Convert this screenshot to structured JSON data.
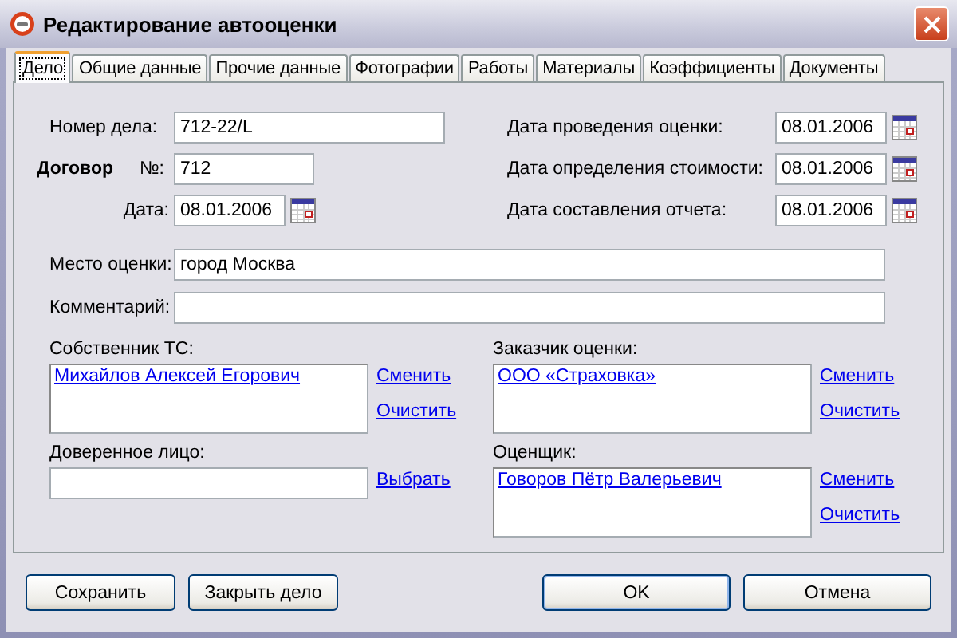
{
  "window": {
    "title": "Редактирование автооценки"
  },
  "tabs": [
    {
      "label": "Дело",
      "selected": true
    },
    {
      "label": "Общие данные",
      "selected": false
    },
    {
      "label": "Прочие данные",
      "selected": false
    },
    {
      "label": "Фотографии",
      "selected": false
    },
    {
      "label": "Работы",
      "selected": false
    },
    {
      "label": "Материалы",
      "selected": false
    },
    {
      "label": "Коэффициенты",
      "selected": false
    },
    {
      "label": "Документы",
      "selected": false
    }
  ],
  "case_number": {
    "label": "Номер дела:",
    "value": "712-22/L"
  },
  "contract": {
    "title": "Договор",
    "number_label": "№:",
    "number": "712",
    "date_label": "Дата:",
    "date": "08.01.2006"
  },
  "dates": [
    {
      "label": "Дата проведения оценки:",
      "value": "08.01.2006"
    },
    {
      "label": "Дата определения стоимости:",
      "value": "08.01.2006"
    },
    {
      "label": "Дата составления отчета:",
      "value": "08.01.2006"
    }
  ],
  "wide_fields": [
    {
      "label": "Место оценки:",
      "value": "город Москва"
    },
    {
      "label": "Комментарий:"
    }
  ],
  "parties": [
    {
      "kind": "box",
      "label": "Собственник ТС:",
      "value": "Михайлов Алексей Егорович",
      "links": [
        "Сменить",
        "Очистить"
      ]
    },
    {
      "kind": "box",
      "label": "Заказчик оценки:",
      "value": "ООО «Страховка»",
      "links": [
        "Сменить",
        "Очистить"
      ]
    },
    {
      "kind": "field",
      "label": "Доверенное лицо:",
      "links": [
        "Выбрать"
      ]
    },
    {
      "kind": "box",
      "label": "Оценщик:",
      "value": "Говоров Пётр Валерьевич",
      "links": [
        "Сменить",
        "Очистить"
      ]
    }
  ],
  "buttons_left": [
    "Сохранить",
    "Закрыть дело"
  ],
  "buttons_right": [
    "OK",
    "Отмена"
  ]
}
